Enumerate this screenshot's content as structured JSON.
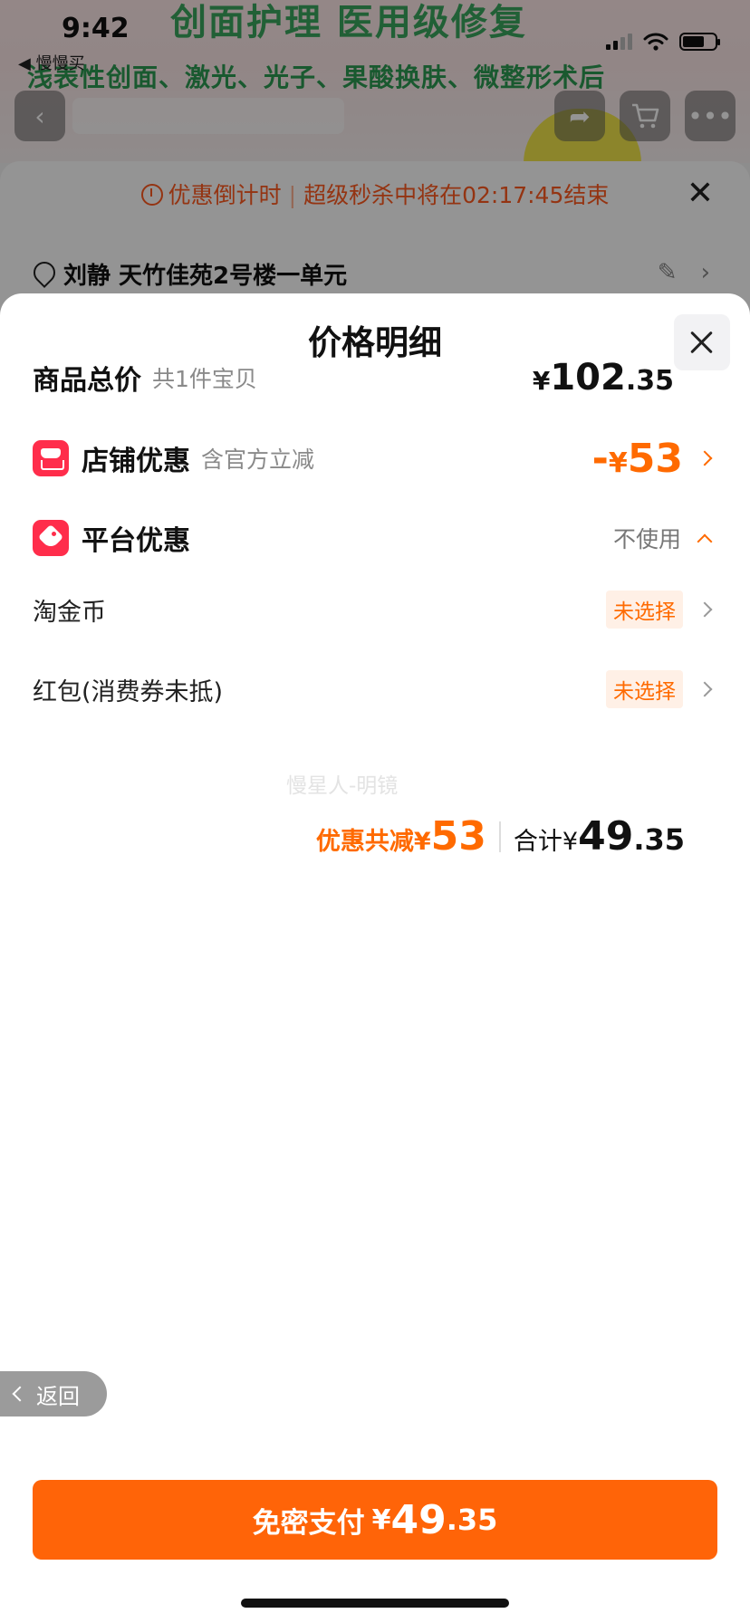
{
  "status_bar": {
    "time": "9:42",
    "back_app": "◀ 慢慢买"
  },
  "background": {
    "banner_line1": "创面护理 医用级修复",
    "banner_line2": "浅表性创面、激光、光子、果酸换肤、微整形术后",
    "countdown": {
      "prefix": "优惠倒计时",
      "text": "超级秒杀中将在02:17:45结束"
    },
    "address": "刘静 天竹佳苑2号楼一单元"
  },
  "sheet": {
    "title": "价格明细",
    "rows": {
      "goods_total": {
        "label": "商品总价",
        "sub": "共1件宝贝",
        "currency": "¥",
        "amount_int": "102",
        "amount_dec": ".35"
      },
      "shop_discount": {
        "label": "店铺优惠",
        "sub": "含官方立减",
        "sign": "-",
        "currency": "¥",
        "amount": "53"
      },
      "platform_discount": {
        "label": "平台优惠",
        "status": "不使用"
      },
      "taojinbi": {
        "label": "淘金币",
        "status": "未选择"
      },
      "red_packet": {
        "label": "红包(消费券未抵)",
        "status": "未选择"
      }
    },
    "summary": {
      "discount_label": "优惠共减",
      "discount_currency": "¥",
      "discount_amount": "53",
      "total_label": "合计",
      "total_currency": "¥",
      "total_int": "49",
      "total_dec": ".35"
    },
    "watermark": "慢星人-明镜",
    "back_label": "返回",
    "pay_button": {
      "label": "免密支付",
      "currency": "¥",
      "amount_int": "49",
      "amount_dec": ".35"
    }
  }
}
